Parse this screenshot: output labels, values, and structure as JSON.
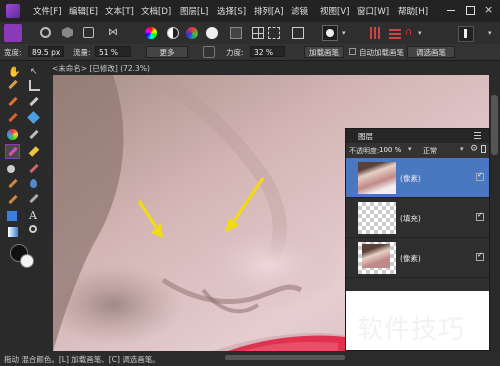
{
  "menu": [
    "文件[F]",
    "编辑[E]",
    "文本[T]",
    "文档[D]",
    "图层[L]",
    "选择[S]",
    "排列[A]",
    "滤镜",
    "视图[V]",
    "窗口[W]",
    "帮助[H]"
  ],
  "context_toolbar": {
    "width_label": "宽度:",
    "width_value": "89.5 px",
    "flow_label": "流量:",
    "flow_value": "51 %",
    "more_label": "更多",
    "force_label": "力度:",
    "force_value": "32 %",
    "add_brush_label": "加载画笔",
    "auto_add_label": "自动加载画笔",
    "select_brush_label": "调选画笔"
  },
  "document_tab": "<未命名> [已修改] (72.3%)",
  "layers_panel": {
    "title": "图层",
    "opacity_label": "不透明度:",
    "opacity_value": "100 %",
    "blend_mode": "正常",
    "layers": [
      {
        "name": "(像素)",
        "selected": true,
        "checked": true
      },
      {
        "name": "(填充)",
        "selected": false,
        "checked": true
      },
      {
        "name": "(像素)",
        "selected": false,
        "checked": true
      }
    ]
  },
  "status_text": "拖动 混合颜色。[L] 加载画笔、[C] 调选画笔。",
  "watermark": "软件技巧",
  "colors": {
    "selected_layer": "#4a78c0",
    "accent_purple": "#8a3ab9",
    "arrow_yellow": "#f2dc10"
  }
}
